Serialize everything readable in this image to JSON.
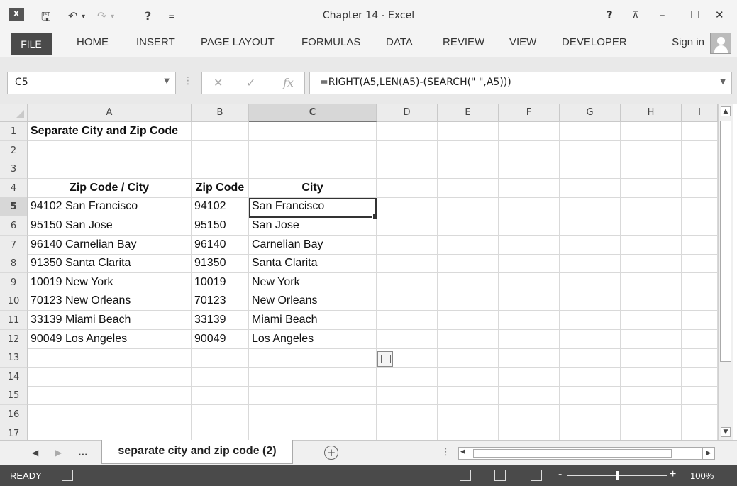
{
  "window": {
    "title": "Chapter 14 - Excel",
    "app_icon": "X",
    "quick_access": {
      "save_icon": "save-icon",
      "undo_icon": "undo-icon",
      "redo_icon": "redo-icon",
      "touch_icon": "touch-mode-icon"
    },
    "controls": {
      "help": "?",
      "ribbon_display": "⊼",
      "minimize": "–",
      "maximize": "☐",
      "close": "✕"
    }
  },
  "ribbon": {
    "tabs": [
      "FILE",
      "HOME",
      "INSERT",
      "PAGE LAYOUT",
      "FORMULAS",
      "DATA",
      "REVIEW",
      "VIEW",
      "DEVELOPER"
    ],
    "sign_in": "Sign in"
  },
  "formula_bar": {
    "name_box": "C5",
    "cancel": "✕",
    "enter": "✓",
    "fx": "fx",
    "formula": "=RIGHT(A5,LEN(A5)-(SEARCH(\" \",A5)))"
  },
  "grid": {
    "columns": [
      "A",
      "B",
      "C",
      "D",
      "E",
      "F",
      "G",
      "H",
      "I"
    ],
    "rows": [
      "1",
      "2",
      "3",
      "4",
      "5",
      "6",
      "7",
      "8",
      "9",
      "10",
      "11",
      "12",
      "13",
      "14",
      "15",
      "16",
      "17"
    ],
    "selected_column": "C",
    "selected_row": "5",
    "title": "Separate City and Zip Code",
    "headers": [
      "Zip Code / City",
      "Zip Code",
      "City"
    ],
    "data": [
      [
        "94102 San Francisco",
        "94102",
        "San Francisco"
      ],
      [
        "95150 San Jose",
        "95150",
        "San Jose"
      ],
      [
        "96140 Carnelian Bay",
        "96140",
        "Carnelian Bay"
      ],
      [
        "91350 Santa Clarita",
        "91350",
        "Santa Clarita"
      ],
      [
        "10019 New York",
        "10019",
        "New York"
      ],
      [
        "70123 New Orleans",
        "70123",
        "New Orleans"
      ],
      [
        "33139 Miami Beach",
        "33139",
        "Miami Beach"
      ],
      [
        "90049 Los Angeles",
        "90049",
        "Los Angeles"
      ]
    ]
  },
  "sheets": {
    "more": "...",
    "active_tab": "separate city and zip code (2)",
    "add": "+"
  },
  "status": {
    "mode": "READY",
    "zoom_minus": "-",
    "zoom_plus": "+",
    "zoom": "100%"
  }
}
